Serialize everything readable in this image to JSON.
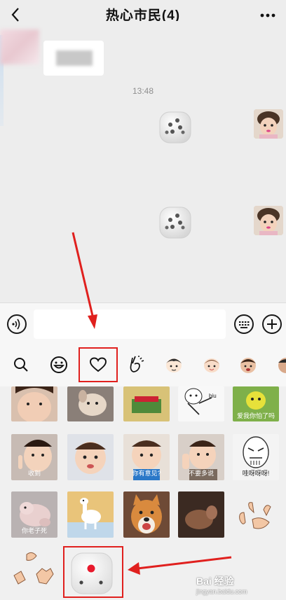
{
  "header": {
    "title": "热心市民(4)",
    "back_icon": "chevron-left-icon",
    "more_icon": "ellipsis-icon"
  },
  "chat": {
    "timestamp": "13:48",
    "messages": [
      {
        "sender": "self",
        "type": "dice-sticker"
      },
      {
        "sender": "self",
        "type": "dice-sticker"
      }
    ]
  },
  "input_bar": {
    "voice_icon": "voice-icon",
    "text_value": "",
    "emoji_keyboard_icon": "keyboard-icon",
    "add_icon": "plus-icon"
  },
  "sticker_tabs": {
    "items": [
      {
        "icon": "search-icon"
      },
      {
        "icon": "smiley-icon"
      },
      {
        "icon": "heart-icon",
        "selected": true
      },
      {
        "icon": "hand-gesture-icon"
      },
      {
        "icon": "sticker-pack-boy-icon"
      },
      {
        "icon": "sticker-pack-child-icon"
      },
      {
        "icon": "sticker-pack-man-icon"
      },
      {
        "icon": "sticker-pack-more-icon"
      }
    ]
  },
  "stickers": {
    "captions": {
      "s8": "爱我你怕了吗",
      "s9": "收到",
      "s11": "你有意见?",
      "s12": "不要多说",
      "s13": "哇呀呀呀!",
      "s14": "你老子死"
    }
  },
  "watermark": {
    "brand": "Bai 经验",
    "url": "jingyan.baidu.com"
  },
  "colors": {
    "background": "#ededed",
    "annotation_red": "#e0201e",
    "dice_pip_red": "#e8192c"
  }
}
